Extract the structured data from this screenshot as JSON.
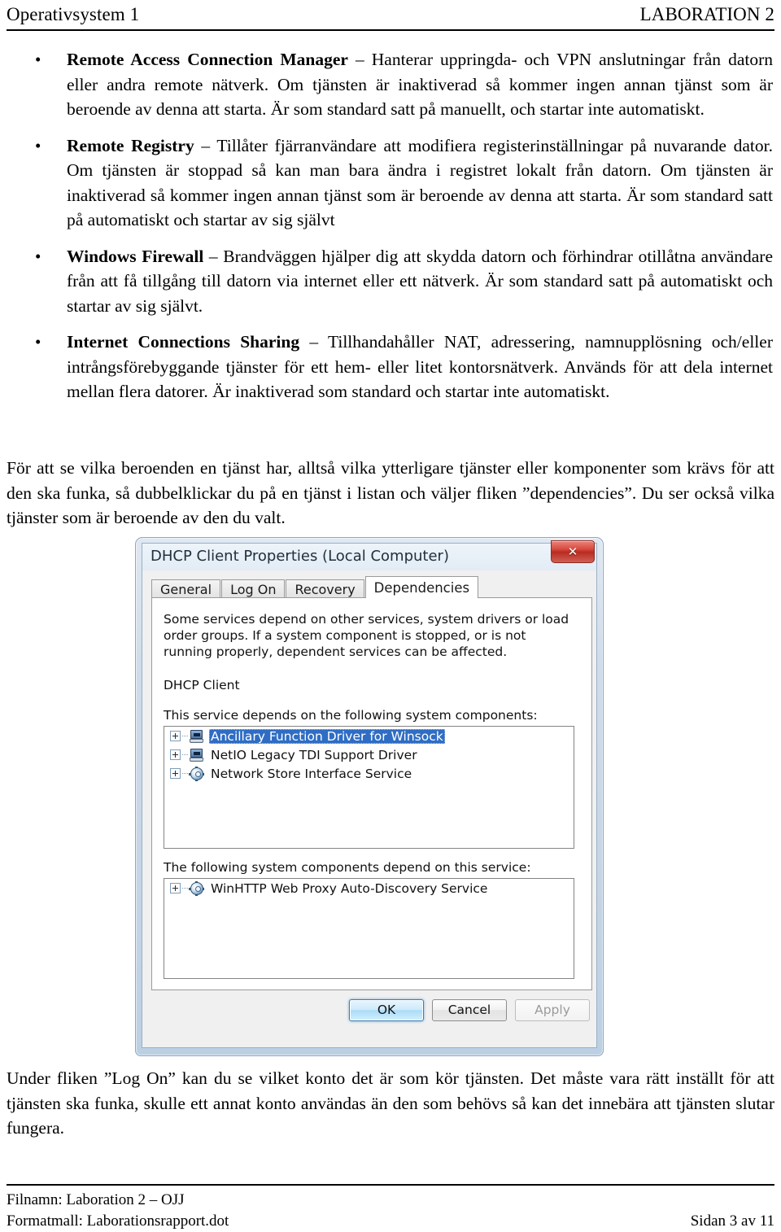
{
  "header": {
    "left": "Operativsystem 1",
    "right": "LABORATION 2"
  },
  "bullets": [
    {
      "term": "Remote Access Connection Manager",
      "dash": " – ",
      "text": "Hanterar uppringda- och VPN anslutningar från datorn eller andra remote nätverk. Om tjänsten är inaktiverad så kommer ingen annan tjänst som är beroende av denna att starta. Är som standard satt på manuellt, och startar inte automatiskt."
    },
    {
      "term": "Remote Registry",
      "dash": " – ",
      "text": "Tillåter fjärranvändare att modifiera registerinställningar på nuvarande dator. Om tjänsten är stoppad så kan man bara ändra i registret lokalt från datorn. Om tjänsten är inaktiverad så kommer ingen annan tjänst som är beroende av denna att starta. Är som standard satt på automatiskt och startar av sig självt"
    },
    {
      "term": "Windows Firewall",
      "dash": " – ",
      "text": "Brandväggen hjälper dig att skydda datorn och förhindrar otillåtna användare från att få tillgång till datorn via internet eller ett nätverk. Är som standard satt på automatiskt och startar av sig självt."
    },
    {
      "term": "Internet Connections Sharing",
      "dash": " – ",
      "text": "Tillhandahåller NAT, adressering, namnupplösning och/eller intrångsförebyggande tjänster för ett hem- eller litet kontorsnätverk. Används för att dela internet mellan flera datorer. Är inaktiverad som standard och startar inte automatiskt."
    }
  ],
  "paragraphs": {
    "intro": "För att se vilka beroenden en tjänst har, alltså vilka ytterligare tjänster eller komponenter som krävs för att den ska funka, så dubbelklickar du på en tjänst i listan och väljer fliken ”dependencies”. Du ser också vilka tjänster som är beroende av den du valt.",
    "outro": "Under fliken ”Log On” kan du se vilket konto det är som kör tjänsten. Det måste vara rätt inställt för att tjänsten ska funka, skulle ett annat konto användas än den som behövs så kan det innebära att tjänsten slutar fungera."
  },
  "dialog": {
    "title": "DHCP Client Properties (Local Computer)",
    "close_label": "✕",
    "tabs": [
      {
        "label": "General",
        "active": false
      },
      {
        "label": "Log On",
        "active": false
      },
      {
        "label": "Recovery",
        "active": false
      },
      {
        "label": "Dependencies",
        "active": true
      }
    ],
    "description": "Some services depend on other services, system drivers or load order groups. If a system component is stopped, or is not running properly, dependent services can be affected.",
    "service_name": "DHCP Client",
    "depends_on_label": "This service depends on the following system components:",
    "depends_on_items": [
      {
        "label": "Ancillary Function Driver for Winsock",
        "icon": "computer-icon",
        "selected": true
      },
      {
        "label": "NetIO Legacy TDI Support Driver",
        "icon": "computer-icon",
        "selected": false
      },
      {
        "label": "Network Store Interface Service",
        "icon": "gear-icon",
        "selected": false
      }
    ],
    "dependents_label": "The following system components depend on this service:",
    "dependents_items": [
      {
        "label": "WinHTTP Web Proxy Auto-Discovery Service",
        "icon": "gear-icon",
        "selected": false
      }
    ],
    "buttons": {
      "ok": "OK",
      "cancel": "Cancel",
      "apply": "Apply"
    },
    "colors": {
      "selection_blue": "#2f6dc4",
      "close_red": "#c4362a",
      "default_button_blue": "#3c7fb1"
    }
  },
  "footer": {
    "line1": "Filnamn: Laboration 2 – OJJ",
    "line2": "Formatmall: Laborationsrapport.dot",
    "page": "Sidan 3 av 11"
  }
}
